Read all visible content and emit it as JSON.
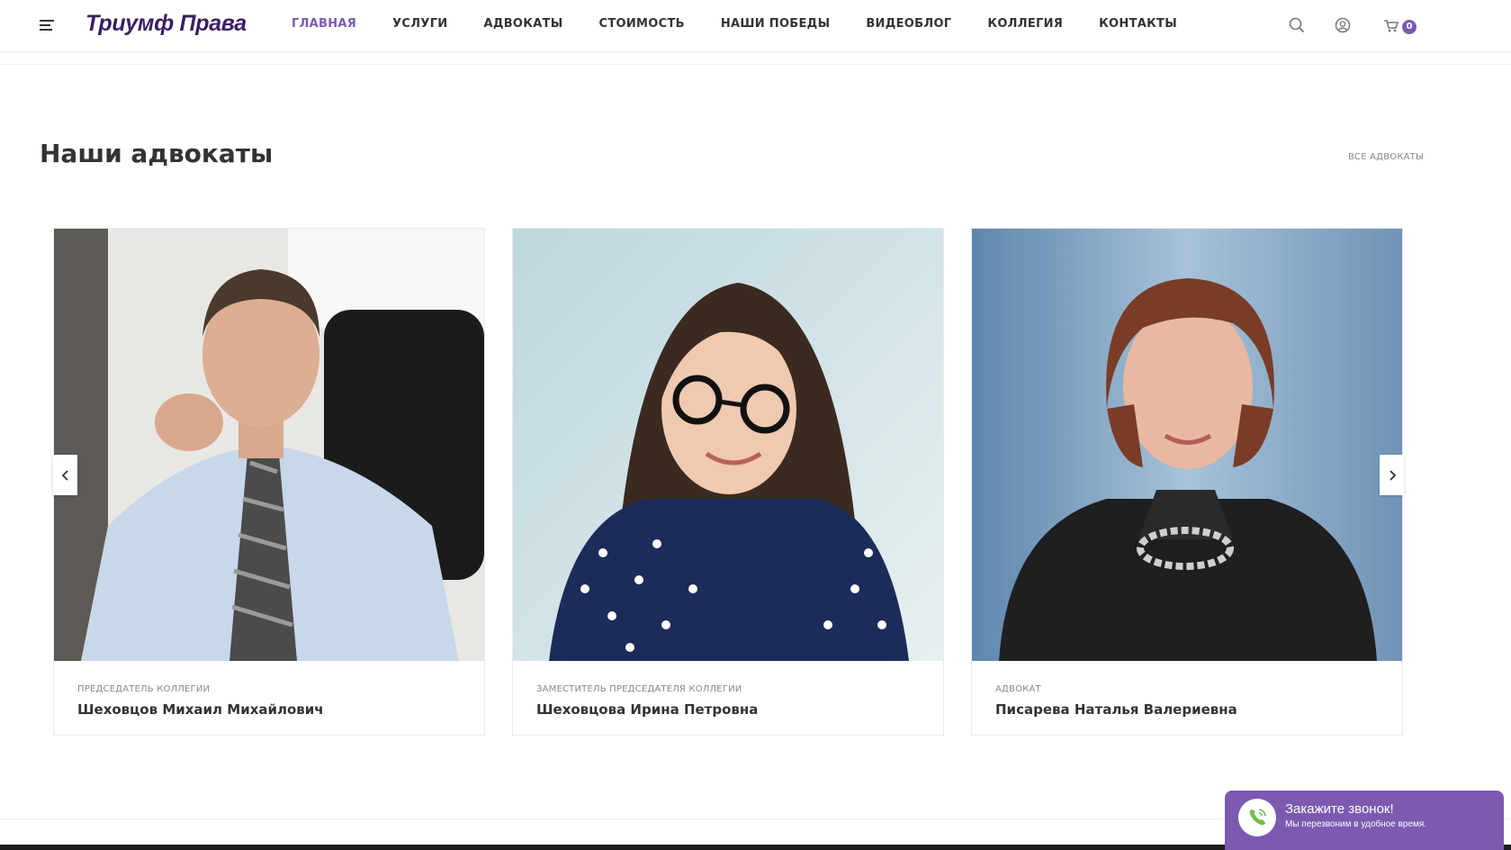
{
  "header": {
    "logo": "Триумф Права",
    "nav": [
      "ГЛАВНАЯ",
      "УСЛУГИ",
      "АДВОКАТЫ",
      "СТОИМОСТЬ",
      "НАШИ ПОБЕДЫ",
      "ВИДЕОБЛОГ",
      "КОЛЛЕГИЯ",
      "КОНТАКТЫ"
    ],
    "active_nav": "ГЛАВНАЯ",
    "cart_count": "0"
  },
  "section": {
    "title": "Наши адвокаты",
    "all_link": "ВСЕ АДВОКАТЫ"
  },
  "lawyers": [
    {
      "role": "ПРЕДСЕДАТЕЛЬ КОЛЛЕГИИ",
      "name": "Шеховцов Михаил Михайлович"
    },
    {
      "role": "ЗАМЕСТИТЕЛЬ ПРЕДСЕДАТЕЛЯ КОЛЛЕГИИ",
      "name": "Шеховцова Ирина Петровна"
    },
    {
      "role": "АДВОКАТ",
      "name": "Писарева Наталья Валериевна"
    }
  ],
  "callback": {
    "title": "Закажите звонок!",
    "subtitle": "Мы перезвоним в удобное время."
  },
  "colors": {
    "accent": "#7b5ab0",
    "logo": "#3a1e63",
    "text": "#333333"
  },
  "icons": [
    "menu-icon",
    "search-icon",
    "user-icon",
    "cart-icon",
    "chevron-left-icon",
    "chevron-right-icon",
    "phone-icon"
  ]
}
